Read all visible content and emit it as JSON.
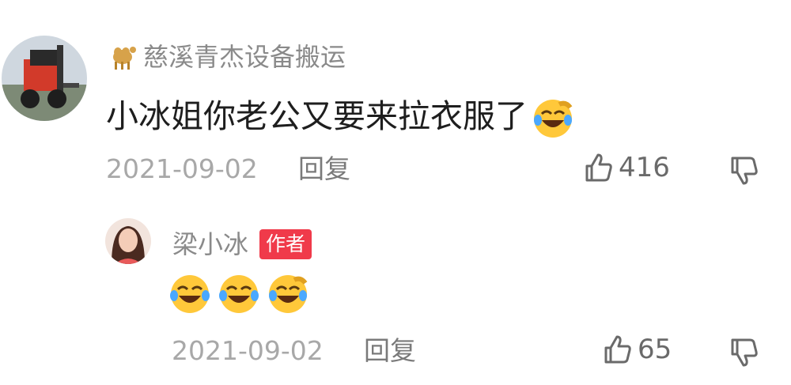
{
  "comments": [
    {
      "username": "慈溪青杰设备搬运",
      "text": "小冰姐你老公又要来拉衣服了",
      "trailing_emoji": "laughing-crying-emoji",
      "date": "2021-09-02",
      "reply_label": "回复",
      "like_count": "416"
    },
    {
      "username": "梁小冰",
      "author_badge": "作者",
      "emojis": [
        "laughing-crying-emoji",
        "laughing-crying-emoji",
        "laughing-crying-emoji"
      ],
      "date": "2021-09-02",
      "reply_label": "回复",
      "like_count": "65"
    }
  ],
  "icons": {
    "like": "thumbs-up-icon",
    "dislike": "thumbs-down-icon",
    "username_prefix": "camel-icon"
  },
  "colors": {
    "author_badge_bg": "#f03a4a",
    "username": "#8a8a8a",
    "meta": "#a8a8a8",
    "emoji_yellow": "#ffc83a"
  }
}
